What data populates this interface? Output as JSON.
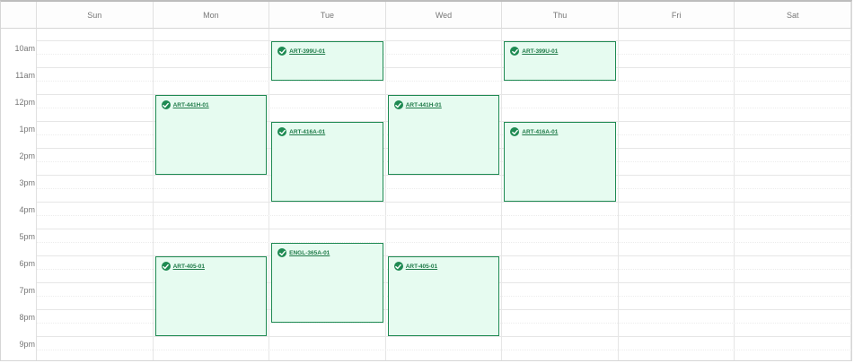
{
  "days": [
    "Sun",
    "Mon",
    "Tue",
    "Wed",
    "Thu",
    "Fri",
    "Sat"
  ],
  "times": [
    "10am",
    "11am",
    "12pm",
    "1pm",
    "2pm",
    "3pm",
    "4pm",
    "5pm",
    "6pm",
    "7pm",
    "8pm",
    "9pm"
  ],
  "colors": {
    "event_fill": "#e6fbf0",
    "event_border": "#1e8a52",
    "check": "#1e8a52"
  },
  "events": [
    {
      "day": "Tue",
      "start": "10am",
      "end": "11:30am",
      "code": "ART-399U-01",
      "status_icon": "check-circle-icon"
    },
    {
      "day": "Thu",
      "start": "10am",
      "end": "11:30am",
      "code": "ART-399U-01",
      "status_icon": "check-circle-icon"
    },
    {
      "day": "Mon",
      "start": "12pm",
      "end": "3pm",
      "code": "ART-441H-01",
      "status_icon": "check-circle-icon"
    },
    {
      "day": "Wed",
      "start": "12pm",
      "end": "3pm",
      "code": "ART-441H-01",
      "status_icon": "check-circle-icon"
    },
    {
      "day": "Tue",
      "start": "1pm",
      "end": "4pm",
      "code": "ART-416A-01",
      "status_icon": "check-circle-icon"
    },
    {
      "day": "Thu",
      "start": "1pm",
      "end": "4pm",
      "code": "ART-416A-01",
      "status_icon": "check-circle-icon"
    },
    {
      "day": "Tue",
      "start": "5:30pm",
      "end": "8:30pm",
      "code": "ENGL-365A-01",
      "status_icon": "check-circle-icon"
    },
    {
      "day": "Mon",
      "start": "6pm",
      "end": "9pm",
      "code": "ART-405-01",
      "status_icon": "check-circle-icon"
    },
    {
      "day": "Wed",
      "start": "6pm",
      "end": "9pm",
      "code": "ART-405-01",
      "status_icon": "check-circle-icon"
    }
  ]
}
